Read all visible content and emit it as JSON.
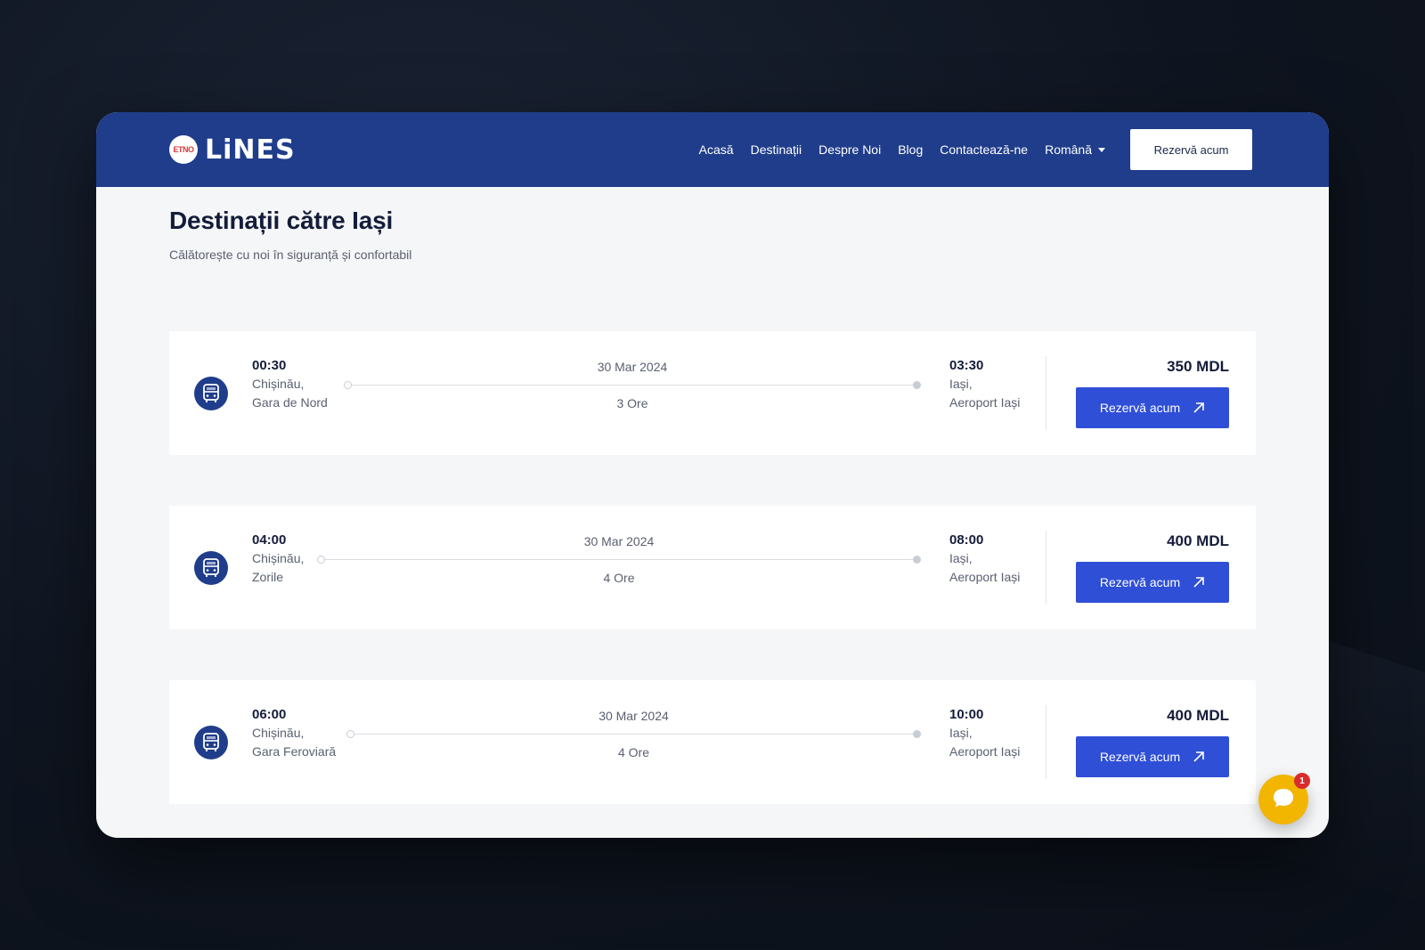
{
  "brand": {
    "logo_text": "LiNES",
    "badge_text": "ETNO"
  },
  "nav": {
    "links": [
      "Acasă",
      "Destinații",
      "Despre Noi",
      "Blog",
      "Contactează-ne"
    ],
    "language": "Română",
    "cta": "Rezervă acum"
  },
  "page": {
    "title": "Destinații către Iași",
    "subtitle": "Călătorește cu noi în siguranță și confortabil"
  },
  "trips": [
    {
      "departure": {
        "time": "00:30",
        "city": "Chișinău,",
        "station": "Gara de Nord"
      },
      "date": "30 Mar 2024",
      "duration": "3 Ore",
      "arrival": {
        "time": "03:30",
        "city": "Iași,",
        "station": "Aeroport Iași"
      },
      "price": "350 MDL",
      "button": "Rezervă acum"
    },
    {
      "departure": {
        "time": "04:00",
        "city": "Chișinău,",
        "station": "Zorile"
      },
      "date": "30 Mar 2024",
      "duration": "4 Ore",
      "arrival": {
        "time": "08:00",
        "city": "Iași,",
        "station": "Aeroport Iași"
      },
      "price": "400 MDL",
      "button": "Rezervă acum"
    },
    {
      "departure": {
        "time": "06:00",
        "city": "Chișinău,",
        "station": "Gara Feroviară"
      },
      "date": "30 Mar 2024",
      "duration": "4 Ore",
      "arrival": {
        "time": "10:00",
        "city": "Iași,",
        "station": "Aeroport Iași"
      },
      "price": "400 MDL",
      "button": "Rezervă acum"
    }
  ],
  "chat": {
    "badge_count": "1"
  },
  "icons": {
    "bus": "bus-icon",
    "arrow": "arrow-up-right-icon",
    "chat": "chat-icon",
    "caret": "caret-down-icon"
  },
  "colors": {
    "navbar": "#1f3d8a",
    "primary_button": "#2f4fd6",
    "chat_bubble": "#f2b500",
    "badge": "#d92d2d"
  }
}
